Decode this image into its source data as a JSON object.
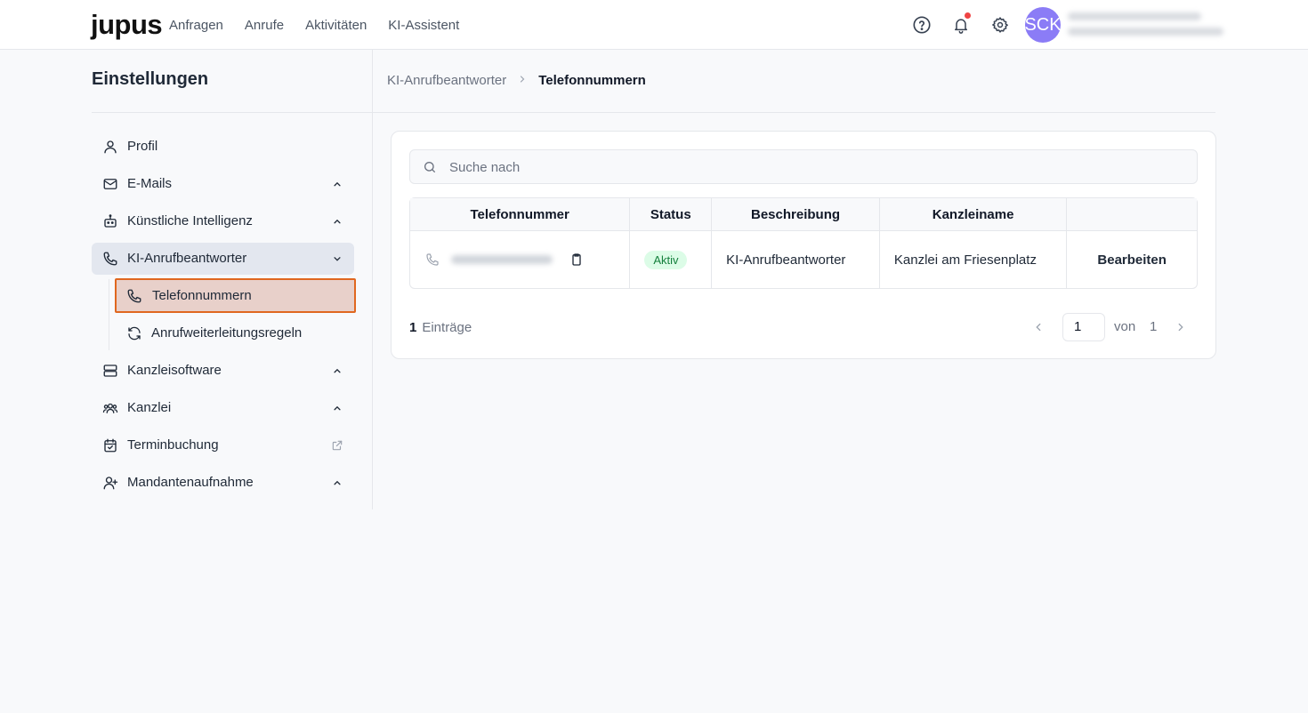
{
  "header": {
    "logo": "jupus",
    "nav": [
      "Anfragen",
      "Anrufe",
      "Aktivitäten",
      "KI-Assistent"
    ],
    "avatar_initials": "SCK",
    "notification_color": "#ef4444",
    "avatar_color": "#8b7cf6"
  },
  "sidebar": {
    "title": "Einstellungen",
    "items": [
      {
        "label": "Profil",
        "icon": "user-icon"
      },
      {
        "label": "E-Mails",
        "icon": "mail-icon"
      },
      {
        "label": "Künstliche Intelligenz",
        "icon": "robot-icon"
      },
      {
        "label": "KI-Anrufbeantworter",
        "icon": "phone-icon"
      },
      {
        "label": "Kanzleisoftware",
        "icon": "server-icon"
      },
      {
        "label": "Kanzlei",
        "icon": "people-icon"
      },
      {
        "label": "Terminbuchung",
        "icon": "calendar-icon"
      },
      {
        "label": "Mandantenaufnahme",
        "icon": "user-plus-icon"
      }
    ],
    "sub_items": [
      {
        "label": "Telefonnummern",
        "icon": "phone-icon"
      },
      {
        "label": "Anrufweiterleitungsregeln",
        "icon": "refresh-icon"
      }
    ]
  },
  "breadcrumb": {
    "parent": "KI-Anrufbeantworter",
    "current": "Telefonnummern"
  },
  "search": {
    "placeholder": "Suche nach"
  },
  "table": {
    "headers": [
      "Telefonnummer",
      "Status",
      "Beschreibung",
      "Kanzleiname",
      ""
    ],
    "rows": [
      {
        "status": "Aktiv",
        "description": "KI-Anrufbeantworter",
        "firm": "Kanzlei am Friesenplatz",
        "action": "Bearbeiten"
      }
    ]
  },
  "footer": {
    "count": "1",
    "entries_label": "Einträge",
    "page": "1",
    "of_label": "von",
    "total_pages": "1"
  },
  "colors": {
    "accent_border": "#e0671f",
    "selected_bg": "#e8d0ca",
    "active_badge_bg": "#dcfce7",
    "active_badge_text": "#15803d"
  }
}
